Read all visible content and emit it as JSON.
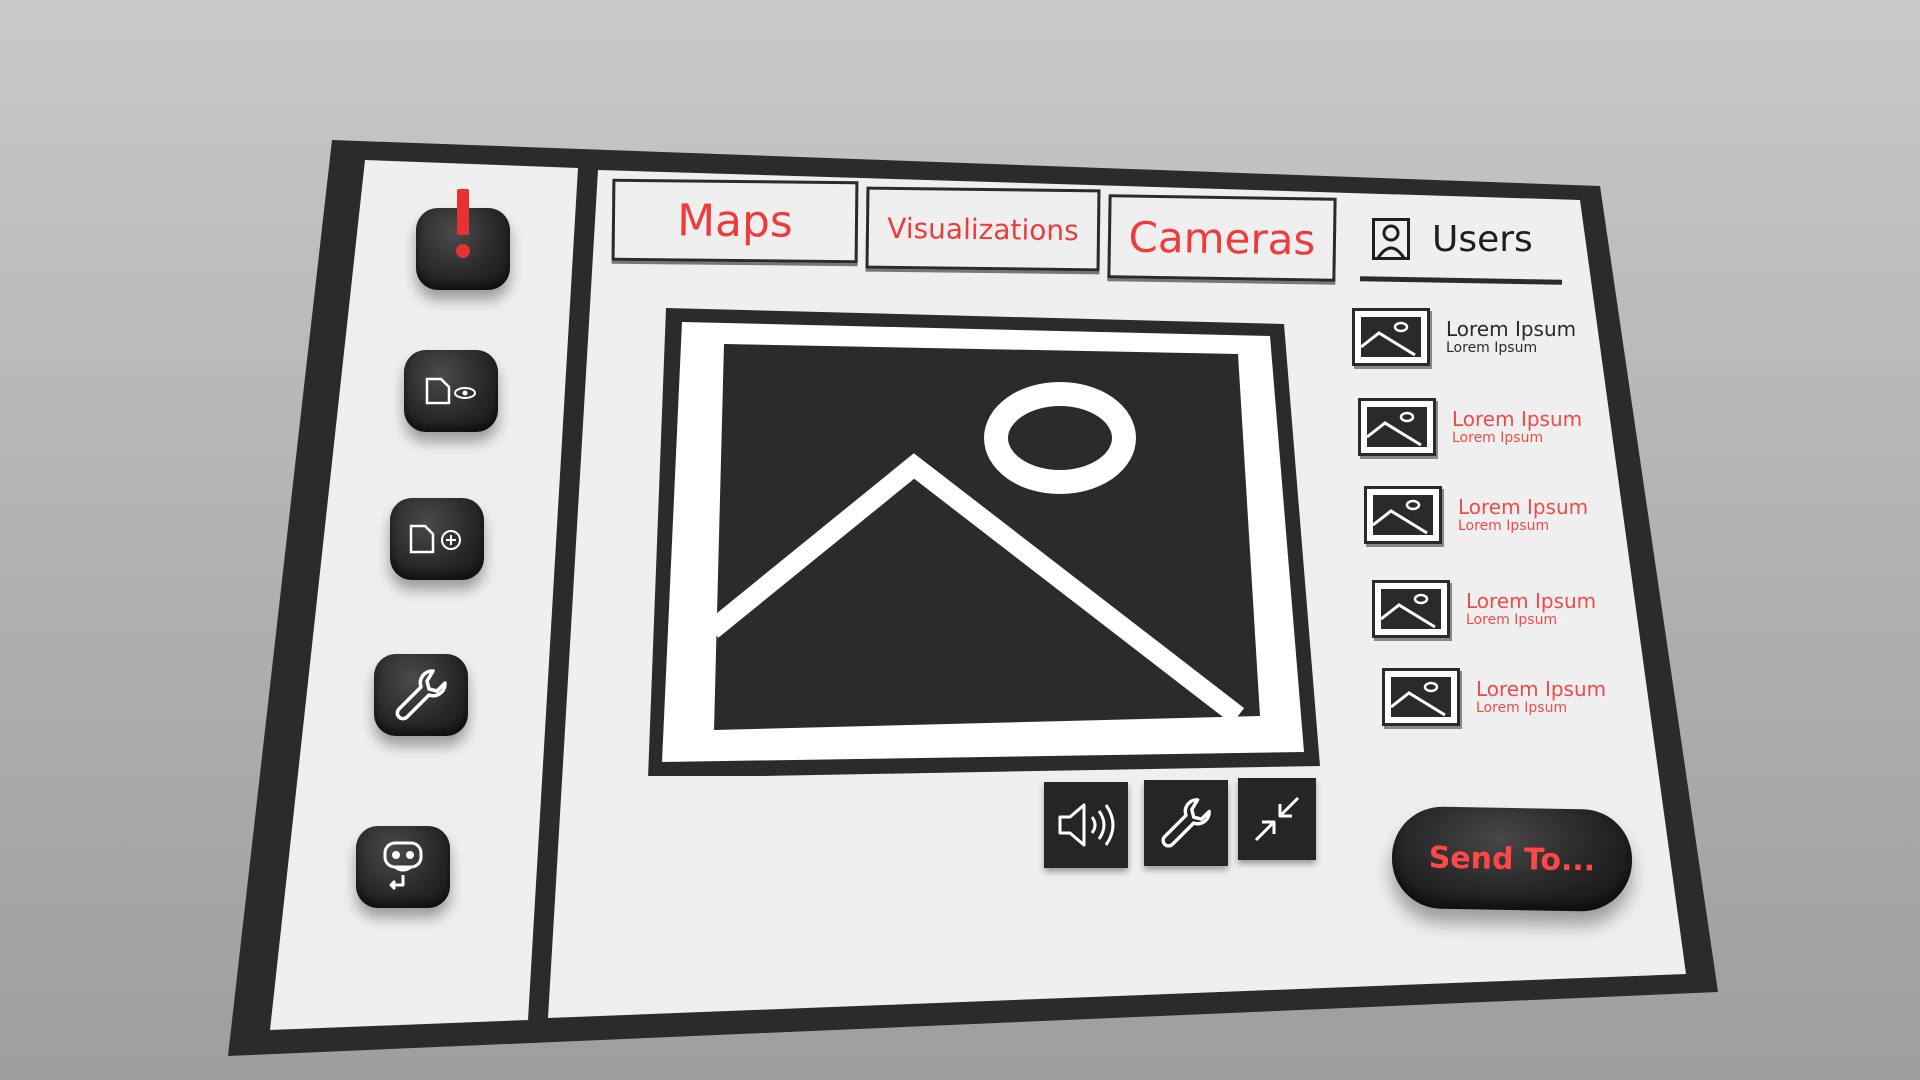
{
  "tabs": [
    {
      "label": "Maps"
    },
    {
      "label": "Visualizations"
    },
    {
      "label": "Cameras"
    }
  ],
  "users_tab": {
    "label": "Users",
    "icon": "user-icon"
  },
  "sidebar": {
    "items": [
      {
        "icon": "alert-icon"
      },
      {
        "icon": "file-view-icon"
      },
      {
        "icon": "file-add-icon"
      },
      {
        "icon": "wrench-icon"
      },
      {
        "icon": "remote-support-icon"
      }
    ]
  },
  "list": {
    "items": [
      {
        "title": "Lorem Ipsum",
        "subtitle": "Lorem Ipsum"
      },
      {
        "title": "Lorem Ipsum",
        "subtitle": "Lorem Ipsum"
      },
      {
        "title": "Lorem Ipsum",
        "subtitle": "Lorem Ipsum"
      },
      {
        "title": "Lorem Ipsum",
        "subtitle": "Lorem Ipsum"
      },
      {
        "title": "Lorem Ipsum",
        "subtitle": "Lorem Ipsum"
      }
    ]
  },
  "toolbar": {
    "items": [
      {
        "icon": "volume-icon"
      },
      {
        "icon": "wrench-icon"
      },
      {
        "icon": "collapse-icon"
      }
    ]
  },
  "send_button": {
    "label": "Send To..."
  },
  "colors": {
    "accent": "#ee3c3c",
    "frame": "#2b2b2b",
    "panel": "#efefef"
  }
}
